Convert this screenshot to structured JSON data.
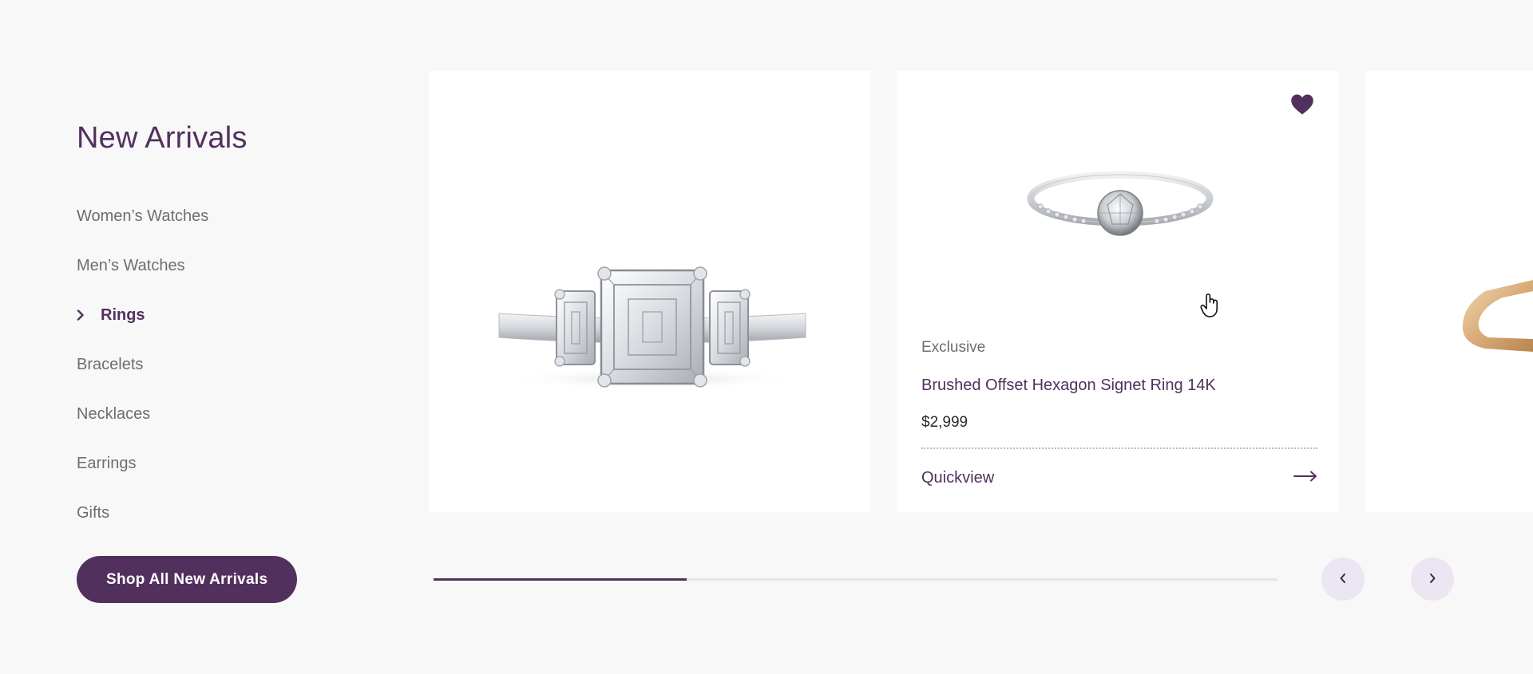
{
  "sidebar": {
    "title": "New Arrivals",
    "categories": [
      {
        "label": "Women’s Watches",
        "active": false
      },
      {
        "label": "Men’s Watches",
        "active": false
      },
      {
        "label": "Rings",
        "active": true
      },
      {
        "label": "Bracelets",
        "active": false
      },
      {
        "label": "Necklaces",
        "active": false
      },
      {
        "label": "Earrings",
        "active": false
      },
      {
        "label": "Gifts",
        "active": false
      }
    ],
    "shop_all_label": "Shop All New Arrivals"
  },
  "products": [
    {
      "image_icon": "emerald-cut-ring-image"
    },
    {
      "tag": "Exclusive",
      "name": "Brushed Offset Hexagon Signet Ring 14K",
      "price": "$2,999",
      "quickview_label": "Quickview",
      "favorited": true,
      "image_icon": "solitaire-ring-image"
    },
    {
      "image_icon": "gold-band-ring-image"
    }
  ],
  "carousel": {
    "progress": 0.3
  },
  "colors": {
    "brand": "#52305e",
    "background": "#f8f8f8",
    "nav_button_bg": "#ebe6f2",
    "text_muted": "#6e6e6e"
  }
}
